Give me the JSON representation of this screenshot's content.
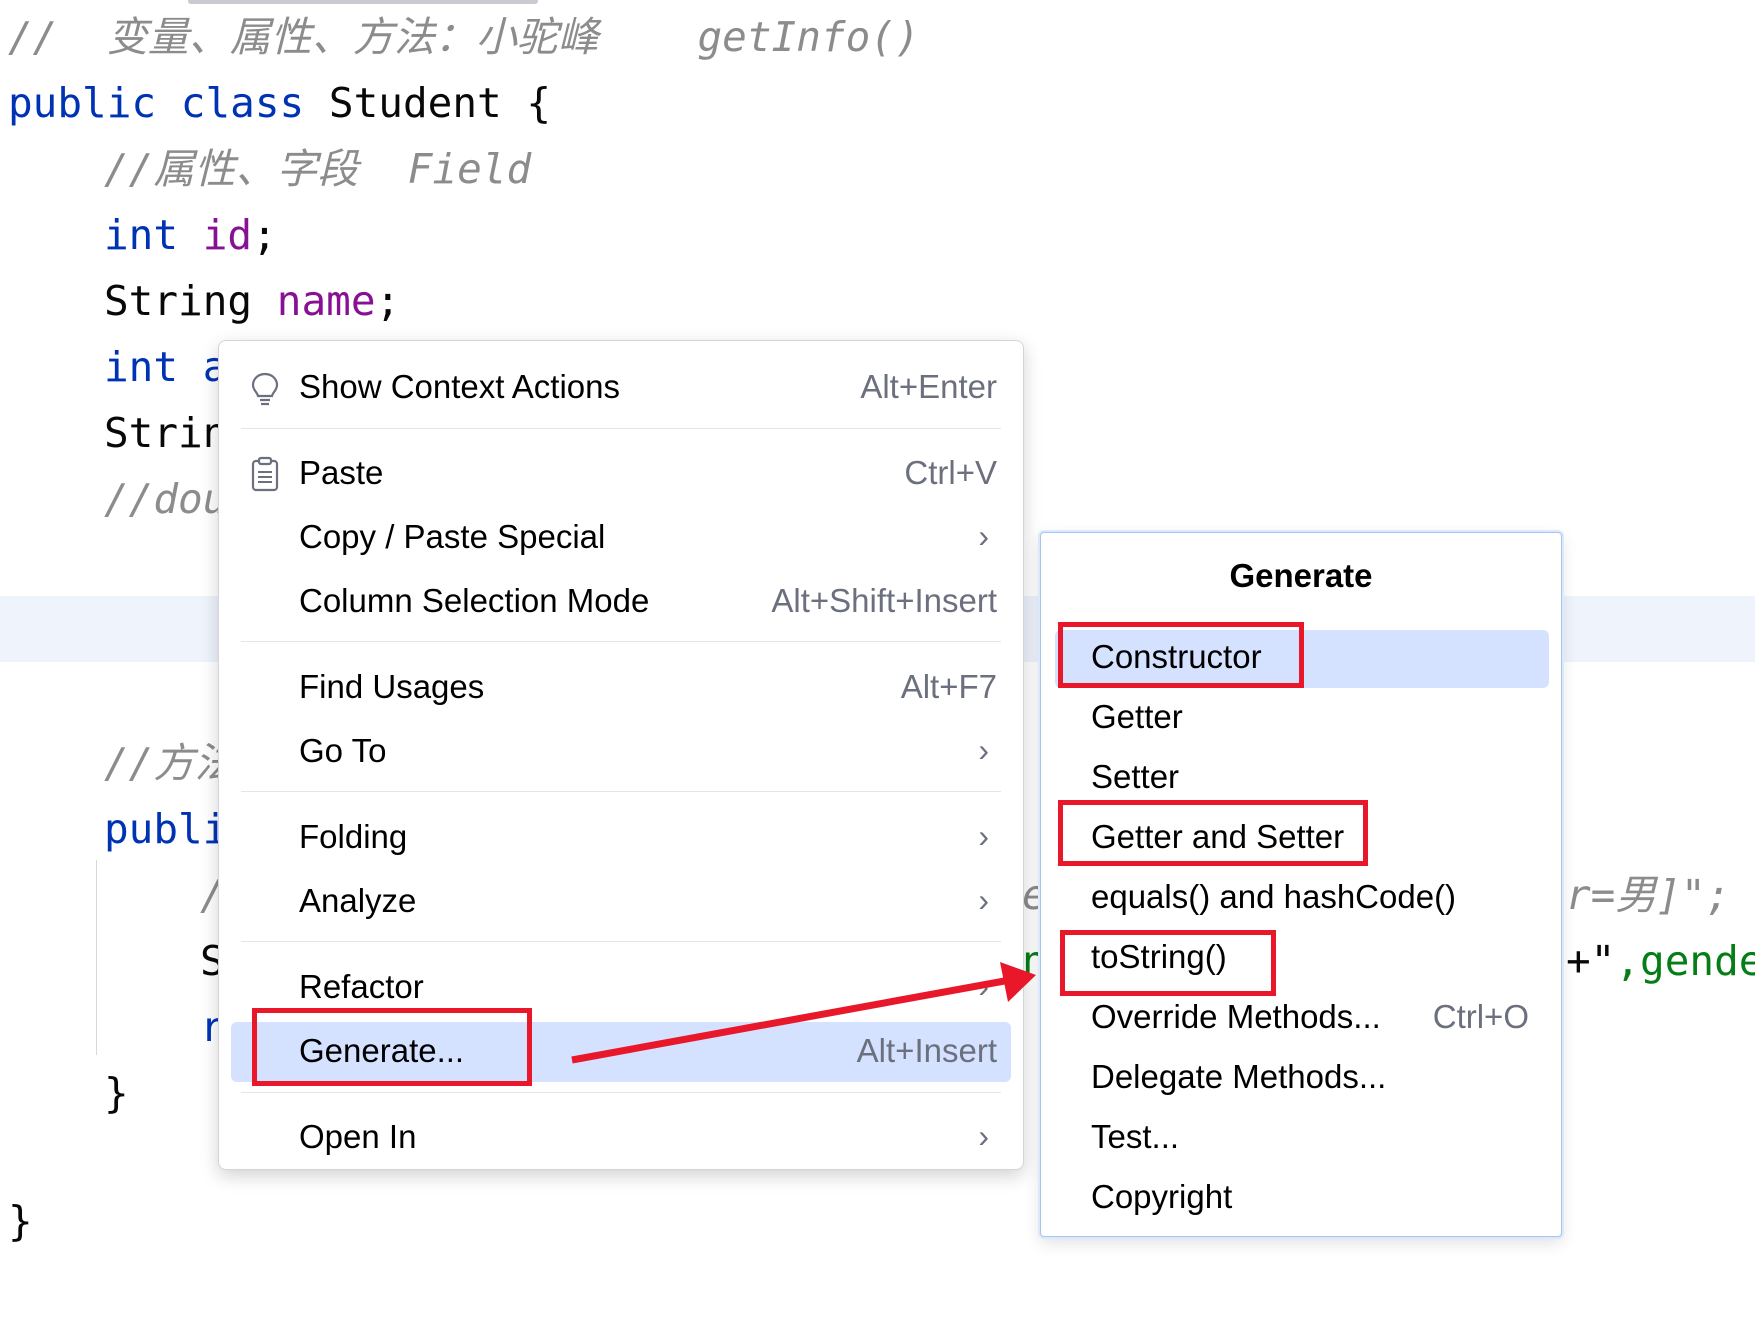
{
  "editor": {
    "lines": {
      "comment_top": "//  变量、属性、方法：小驼峰    getInfo()",
      "class_kw1": "public",
      "class_kw2": "class",
      "class_name": "Student {",
      "comment_field": "//属性、字段  Field",
      "l_int": "int",
      "l_id": "id",
      "semi": ";",
      "l_string": "String",
      "l_name": "name",
      "l_int2": "int a",
      "l_strin": "Strin",
      "l_dou": "//dou",
      "l_method_cmt": "//方法",
      "l_publi": "publi",
      "l_slash": "/",
      "l_S": "S",
      "l_r": "r",
      "l_brace_inner": "}",
      "l_brace_outer": "}",
      "frag_e": "e",
      "frag_n": "n",
      "frag_gender_cmt": "r=男]\";",
      "frag_plus": "+\"",
      "frag_gender": ",gende"
    }
  },
  "context_menu": {
    "items": [
      {
        "label": "Show Context Actions",
        "shortcut": "Alt+Enter",
        "icon": "lightbulb-icon"
      },
      {
        "label": "Paste",
        "shortcut": "Ctrl+V",
        "icon": "clipboard-icon"
      },
      {
        "label": "Copy / Paste Special",
        "arrow": "›"
      },
      {
        "label": "Column Selection Mode",
        "shortcut": "Alt+Shift+Insert"
      },
      {
        "label": "Find Usages",
        "shortcut": "Alt+F7"
      },
      {
        "label": "Go To",
        "arrow": "›"
      },
      {
        "label": "Folding",
        "arrow": "›"
      },
      {
        "label": "Analyze",
        "arrow": "›"
      },
      {
        "label": "Refactor",
        "arrow": "›"
      },
      {
        "label": "Generate...",
        "shortcut": "Alt+Insert",
        "selected": true
      },
      {
        "label": "Open In",
        "arrow": "›"
      }
    ]
  },
  "generate_popup": {
    "title": "Generate",
    "items": [
      {
        "label": "Constructor",
        "selected": true
      },
      {
        "label": "Getter"
      },
      {
        "label": "Setter"
      },
      {
        "label": "Getter and Setter"
      },
      {
        "label": "equals() and hashCode()"
      },
      {
        "label": "toString()"
      },
      {
        "label": "Override Methods...",
        "shortcut": "Ctrl+O"
      },
      {
        "label": "Delegate Methods..."
      },
      {
        "label": "Test..."
      },
      {
        "label": "Copyright"
      }
    ]
  },
  "annotations": {
    "highlight_color": "#e8182a",
    "highlighted_items": [
      "Generate...",
      "Constructor",
      "Getter and Setter",
      "toString()"
    ]
  },
  "colors": {
    "keyword": "#0033b3",
    "field": "#871094",
    "comment": "#8c8c8c",
    "string": "#067d17",
    "selection": "#d4e2ff"
  }
}
